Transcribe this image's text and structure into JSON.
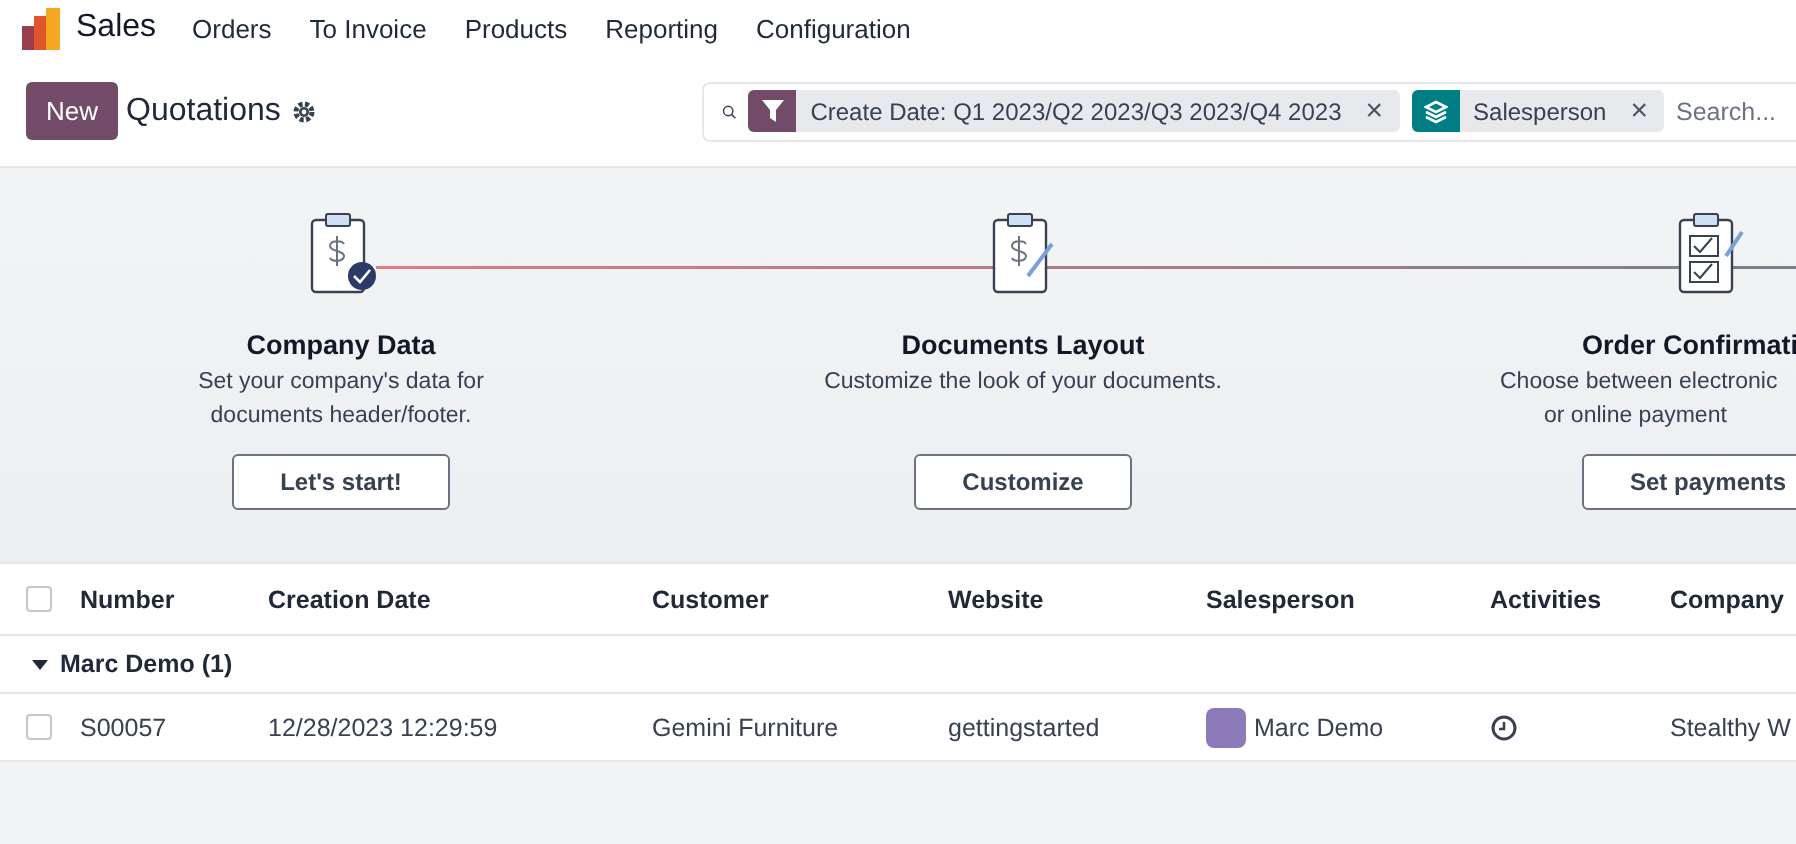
{
  "navbar": {
    "app": "Sales",
    "menu": [
      "Orders",
      "To Invoice",
      "Products",
      "Reporting",
      "Configuration"
    ]
  },
  "control_panel": {
    "new_button": "New",
    "title": "Quotations",
    "facets": [
      {
        "kind": "filter",
        "label": "Create Date: Q1 2023/Q2 2023/Q3 2023/Q4 2023",
        "remove": "×"
      },
      {
        "kind": "group",
        "label": "Salesperson",
        "remove": "×"
      }
    ],
    "search": {
      "placeholder": "Search..."
    }
  },
  "onboarding": [
    {
      "kind": "money-done",
      "title": "Company Data",
      "lines": [
        "Set your company's data for",
        "documents header/footer."
      ],
      "button": "Let's start!"
    },
    {
      "kind": "money",
      "title": "Documents Layout",
      "lines": [
        "Customize the look of your documents."
      ],
      "button": "Customize"
    },
    {
      "kind": "checklist",
      "title": "Order Confirmati",
      "lines": [
        "Choose between electronic",
        "or online payment"
      ],
      "button": "Set payments"
    }
  ],
  "table": {
    "select_all_checked": false,
    "columns": [
      "Number",
      "Creation Date",
      "Customer",
      "Website",
      "Salesperson",
      "Activities",
      "Company"
    ],
    "groups": [
      {
        "label": "Marc Demo (1)",
        "expanded": true,
        "rows": [
          {
            "selected": false,
            "cells": [
              "S00057",
              "12/28/2023 12:29:59",
              "Gemini Furniture",
              "gettingstarted",
              "Marc Demo",
              "",
              "Stealthy W"
            ]
          }
        ]
      }
    ]
  }
}
